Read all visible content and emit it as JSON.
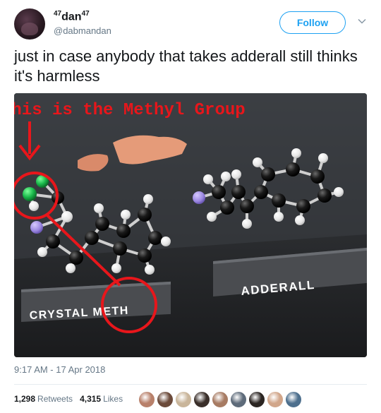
{
  "user": {
    "display_name": "dan",
    "display_name_sup": "47",
    "handle": "@dabmandan",
    "avatar_icon": "profile-photo"
  },
  "follow_label": "Follow",
  "menu_icon": "chevron-down-icon",
  "tweet": {
    "text": "just in case anybody that takes adderall still thinks it's harmless"
  },
  "media": {
    "annotation_text": "This is the Methyl Group",
    "label_left": "CRYSTAL METH",
    "label_right": "ADDERALL",
    "annotation_color": "#e8161b"
  },
  "timestamp": "9:17 AM - 17 Apr 2018",
  "stats": {
    "retweets_count": "1,298",
    "retweets_label": "Retweets",
    "likes_count": "4,315",
    "likes_label": "Likes"
  },
  "liker_colors": [
    "#b8806a",
    "#6b4a3a",
    "#c9b59a",
    "#3a2f2a",
    "#a77b63",
    "#5e6b7a",
    "#2b2522",
    "#d1a68a",
    "#4d6f8d"
  ],
  "colors": {
    "accent": "#1da1f2",
    "text": "#14171a",
    "muted": "#657786"
  }
}
